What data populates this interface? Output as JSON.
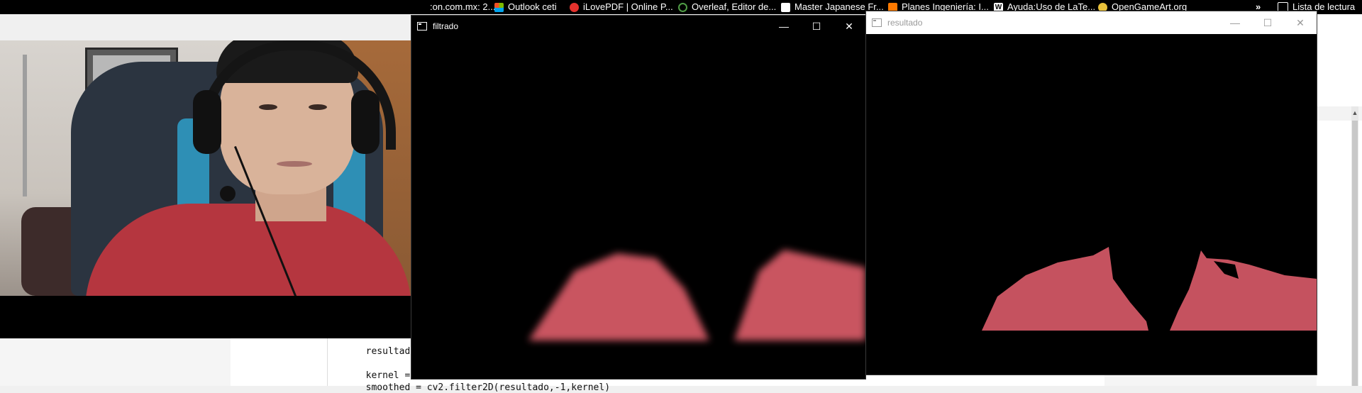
{
  "bookmarks": [
    {
      "label": ":on.com.mx: 2...",
      "icon": "link-icon",
      "color": "#000000"
    },
    {
      "label": "Outlook ceti",
      "icon": "microsoft-icon",
      "color": "#f25022"
    },
    {
      "label": "iLovePDF | Online P...",
      "icon": "ilovepdf-icon",
      "color": "#e5322d"
    },
    {
      "label": "Overleaf, Editor de...",
      "icon": "overleaf-icon",
      "color": "#4f9c45"
    },
    {
      "label": "Master Japanese Fr...",
      "icon": "japanese-icon",
      "color": "#ffffff"
    },
    {
      "label": "Planes Ingeniería: I...",
      "icon": "planes-icon",
      "color": "#ff7a00"
    },
    {
      "label": "Ayuda:Uso de LaTe...",
      "icon": "wikipedia-icon",
      "color": "#ffffff"
    },
    {
      "label": "OpenGameArt.org",
      "icon": "opengameart-icon",
      "color": "#e8c13a"
    }
  ],
  "bookmarks_more": "»",
  "reading_list": "Lista de lectura",
  "windows": {
    "filtrado": {
      "title": "filtrado"
    },
    "resultado": {
      "title": "resultado"
    }
  },
  "window_controls": {
    "minimize": "—",
    "maximize": "☐",
    "close": "✕"
  },
  "code": {
    "line1": "resultado",
    "line2_var": "kernel = ",
    "line3_var": "smoothed = ",
    "line3_call": "cv2.filter2D(resultado,-1,kernel)"
  }
}
